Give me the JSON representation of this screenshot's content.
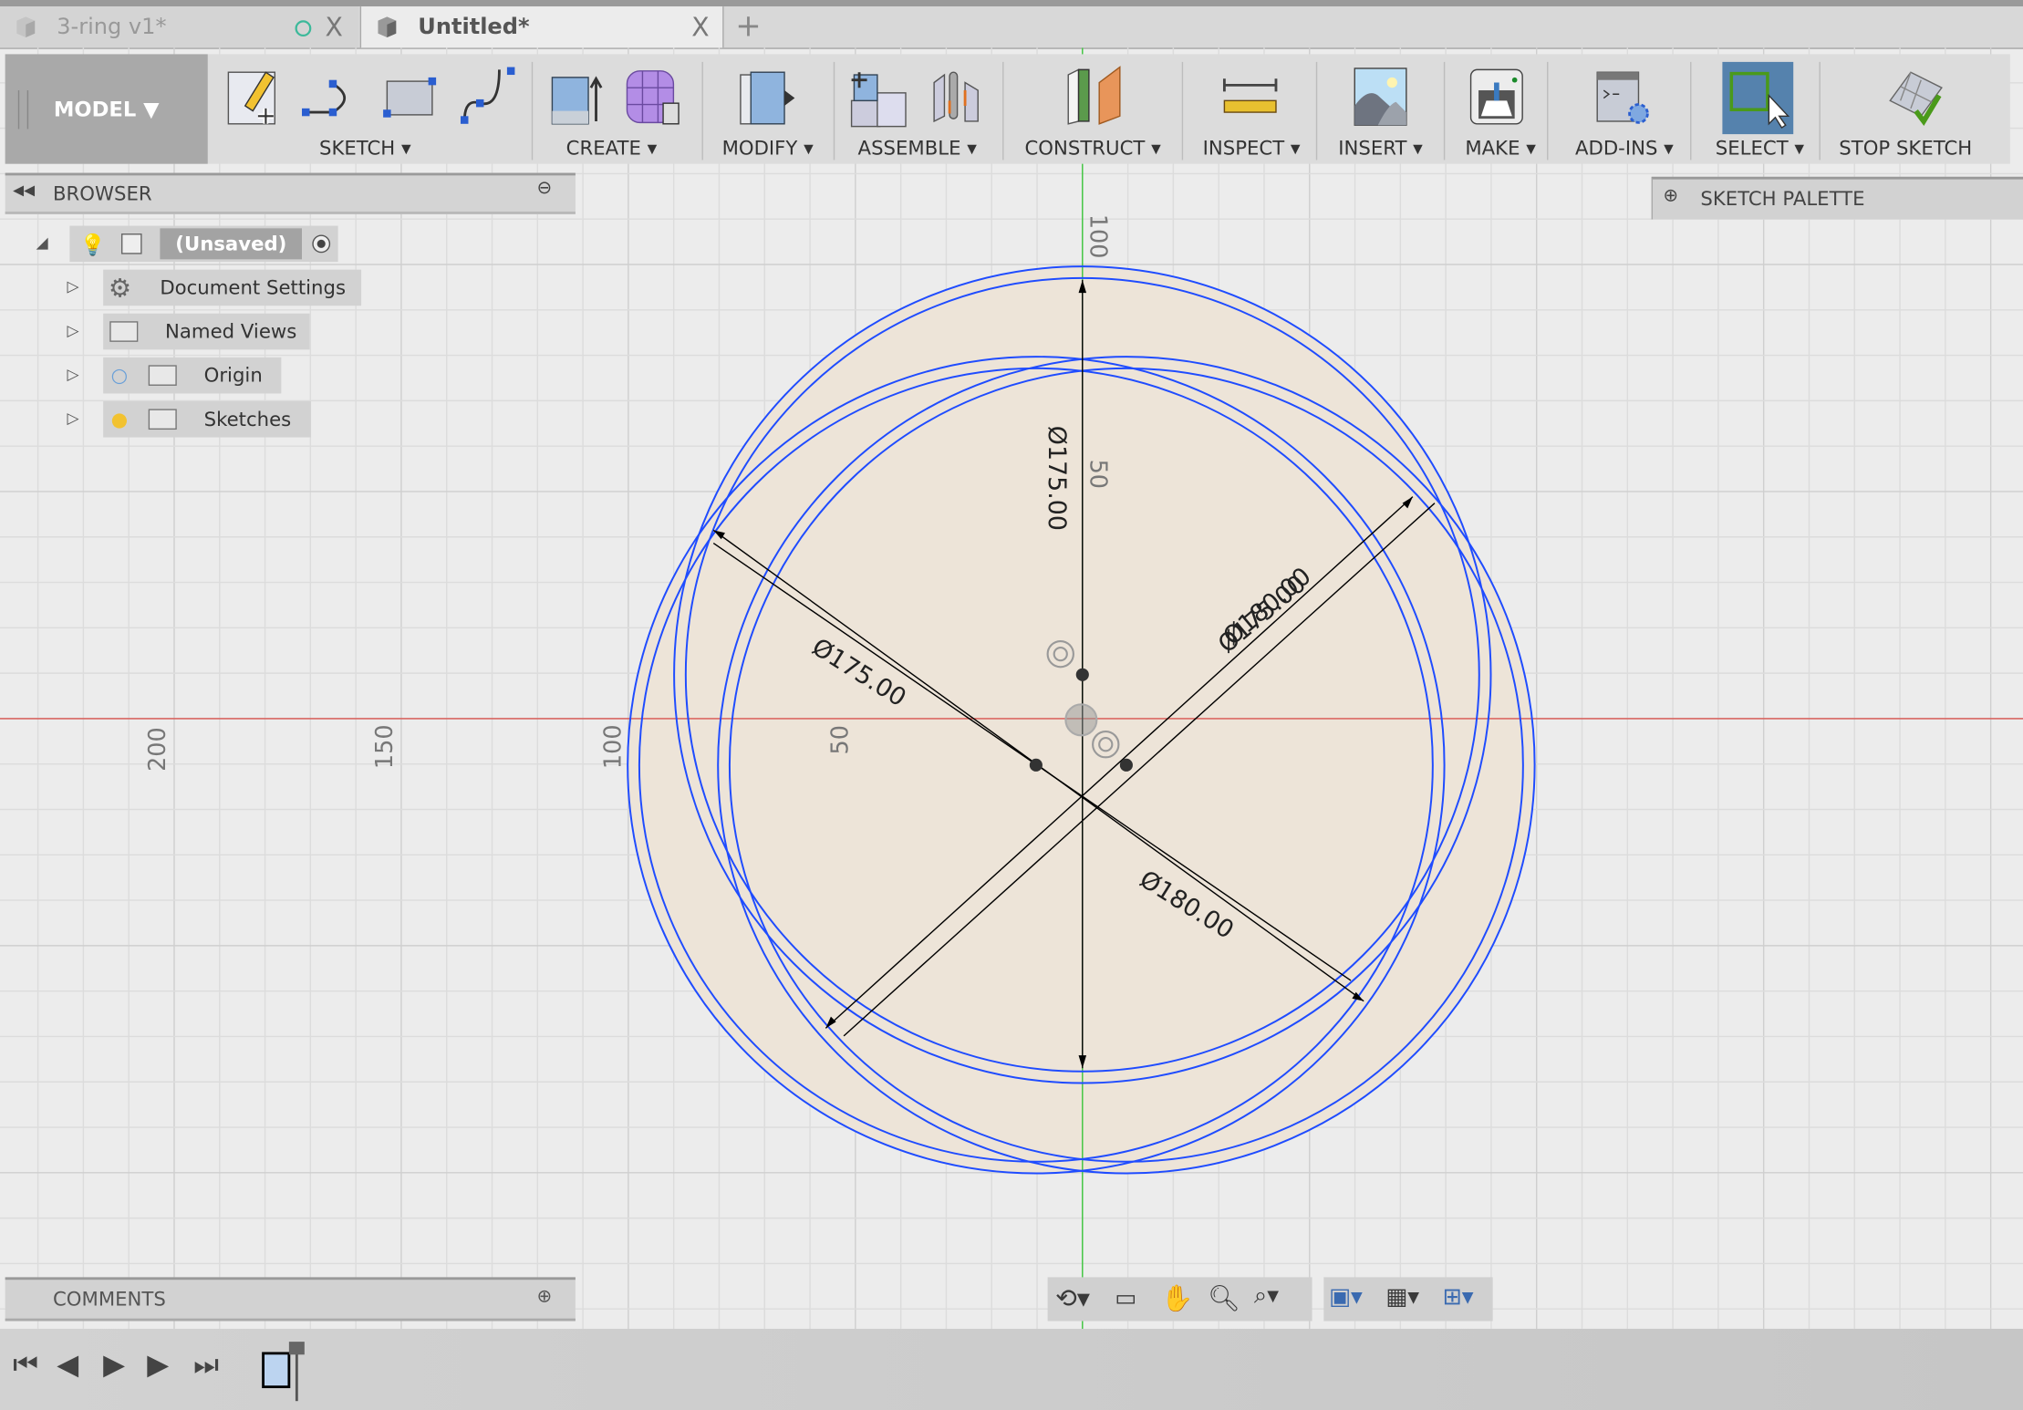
{
  "tabs": [
    {
      "label": "3-ring v1*",
      "active": false,
      "status_icon": "unsaved-circle-icon",
      "close": "X"
    },
    {
      "label": "Untitled*",
      "active": true,
      "close": "X"
    }
  ],
  "new_tab": "+",
  "toolbar": {
    "workspace": "MODEL ▼",
    "groups": [
      {
        "label": "SKETCH ▾"
      },
      {
        "label": "CREATE ▾"
      },
      {
        "label": "MODIFY ▾"
      },
      {
        "label": "ASSEMBLE ▾"
      },
      {
        "label": "CONSTRUCT ▾"
      },
      {
        "label": "INSPECT ▾"
      },
      {
        "label": "INSERT ▾"
      },
      {
        "label": "MAKE ▾"
      },
      {
        "label": "ADD-INS ▾"
      },
      {
        "label": "SELECT ▾"
      },
      {
        "label": "STOP SKETCH"
      }
    ]
  },
  "browser": {
    "title": "BROWSER",
    "root": "(Unsaved)",
    "items": [
      {
        "label": "Document Settings"
      },
      {
        "label": "Named Views"
      },
      {
        "label": "Origin"
      },
      {
        "label": "Sketches"
      }
    ]
  },
  "sketch_palette": "SKETCH PALETTE",
  "comments": "COMMENTS",
  "rulers": {
    "horizontal": [
      "200",
      "150",
      "100",
      "50"
    ],
    "vertical": [
      "100",
      "50"
    ]
  },
  "dimensions": [
    "Ø175.00",
    "Ø175.00",
    "Ø180.00",
    "Ø175.00",
    "Ø180.00"
  ],
  "colors": {
    "sketch_line": "#1f4cff",
    "profile_fill": "#ede4d8",
    "x_axis": "#d9534f",
    "y_axis": "#3cc43c",
    "select_active": "#5582ad"
  }
}
